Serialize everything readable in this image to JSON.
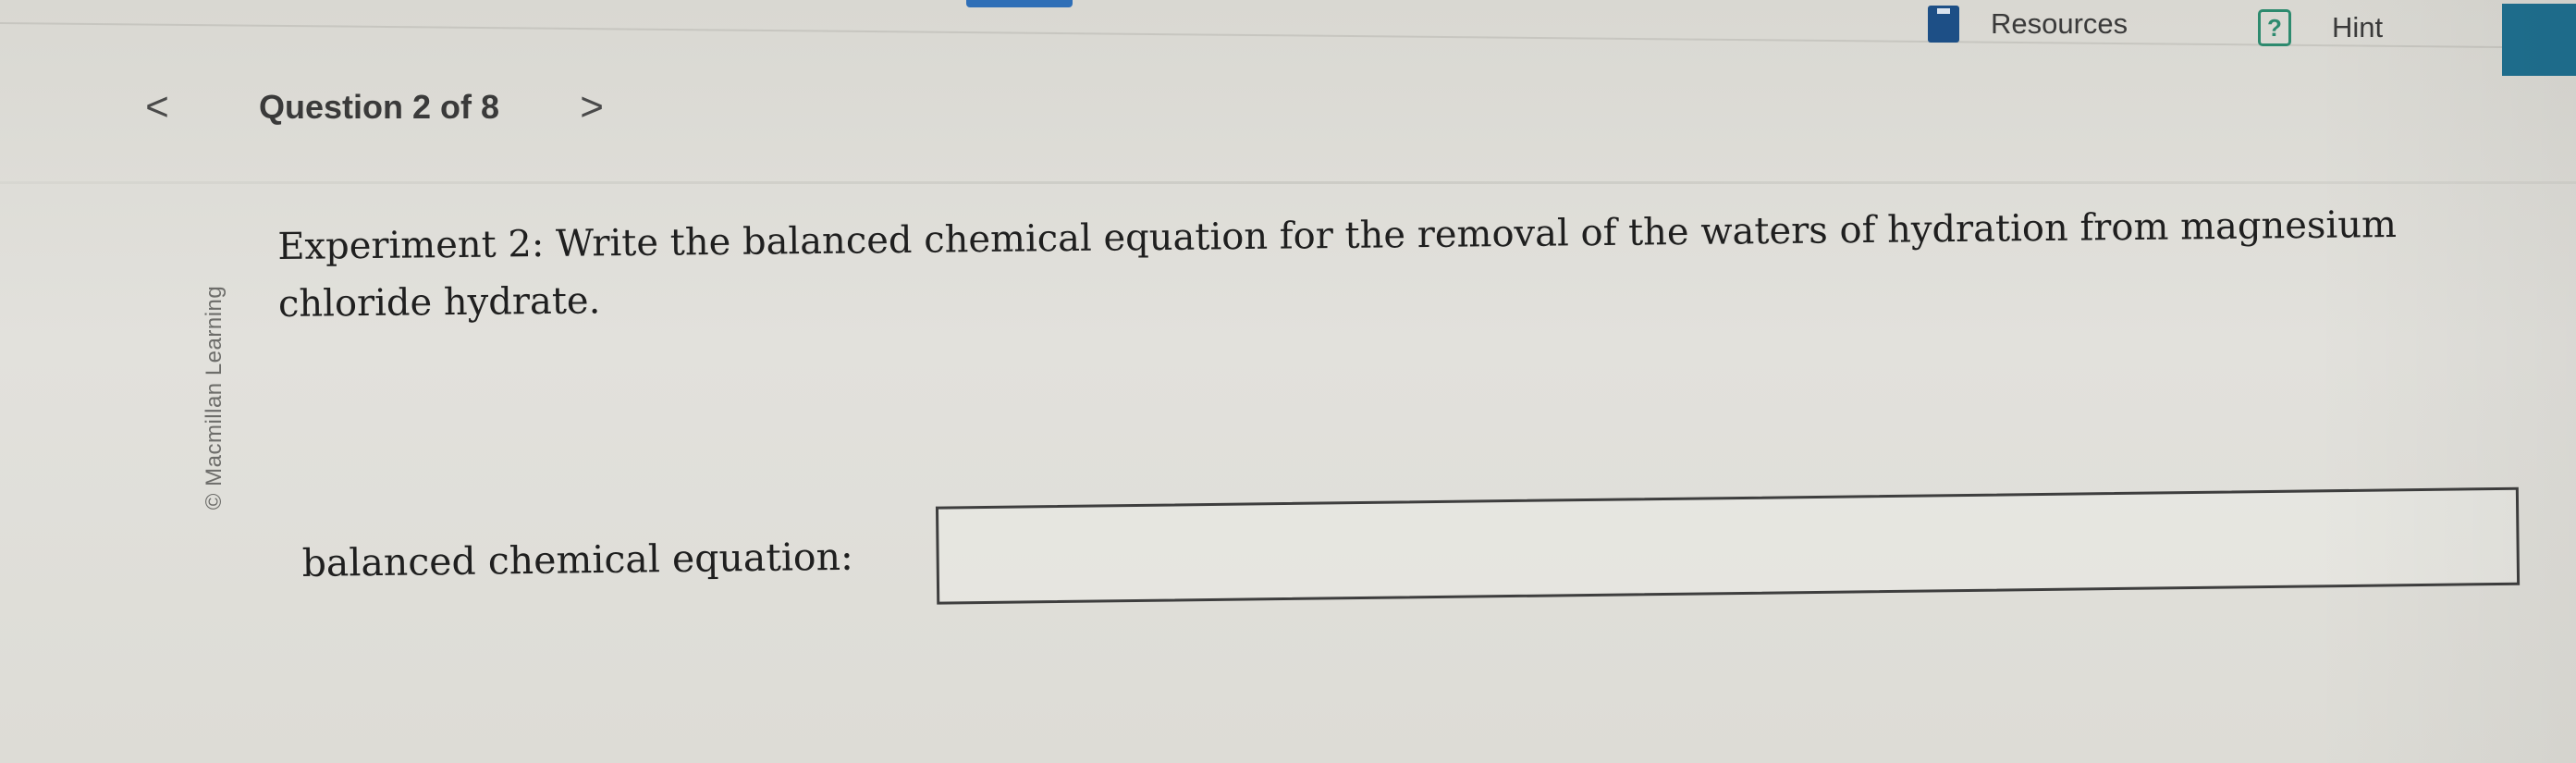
{
  "header": {
    "resources_label": "Resources",
    "hint_label": "Hint",
    "hint_glyph": "?"
  },
  "nav": {
    "prev_glyph": "<",
    "question_counter": "Question 2 of 8",
    "next_glyph": ">"
  },
  "side": {
    "copyright": "© Macmillan Learning"
  },
  "question": {
    "prompt": "Experiment 2: Write the balanced chemical equation for the removal of the waters of hydration from magnesium chloride hydrate.",
    "answer_label": "balanced chemical equation:",
    "answer_value": ""
  },
  "icons": {
    "resources": "book-icon",
    "hint": "question-mark-icon"
  },
  "colors": {
    "accent_blue": "#2f6fb7",
    "resources_icon": "#1d4f86",
    "hint_green": "#2d8a6e",
    "corner_teal": "#1f6f8f"
  }
}
